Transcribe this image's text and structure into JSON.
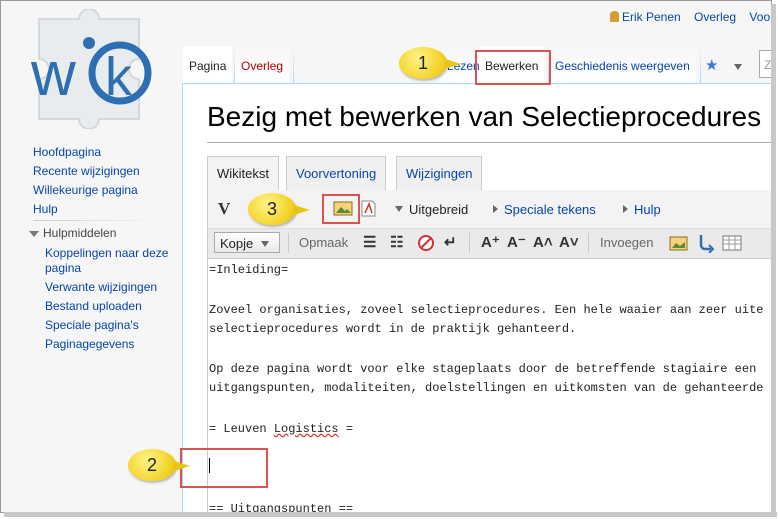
{
  "personal": {
    "user": "Erik Penen",
    "talk": "Overleg",
    "more": "Voor"
  },
  "sidebar": {
    "nav": [
      "Hoofdpagina",
      "Recente wijzigingen",
      "Willekeurige pagina",
      "Hulp"
    ],
    "tools_heading": "Hulpmiddelen",
    "tools": [
      "Koppelingen naar deze pagina",
      "Verwante wijzigingen",
      "Bestand uploaden",
      "Speciale pagina's",
      "Paginagegevens"
    ]
  },
  "tabs": {
    "page": "Pagina",
    "talk": "Overleg",
    "read": "Lezen",
    "edit": "Bewerken",
    "history": "Geschiedenis weergeven",
    "search_placeholder": "Z"
  },
  "page_title": "Bezig met bewerken van Selectieprocedures",
  "editor_tabs": [
    "Wikitekst",
    "Voorvertoning",
    "Wijzigingen"
  ],
  "toolbar1": {
    "advanced": "Uitgebreid",
    "special": "Speciale tekens",
    "help": "Hulp"
  },
  "toolbar2": {
    "heading_select": "Kopje",
    "format": "Opmaak",
    "insert": "Invoegen"
  },
  "editor_lines": [
    "=Inleiding=",
    "",
    "Zoveel organisaties, zoveel selectieprocedures. Een hele waaier aan zeer uite",
    "selectieprocedures wordt in de praktijk gehanteerd.",
    "",
    "Op deze pagina wordt voor elke stageplaats door de betreffende stagiaire een",
    "uitgangspunten, modaliteiten, doelstellingen en uitkomsten van de gehanteerde"
  ],
  "editor_heading": {
    "prefix": "= Leuven ",
    "word": "Logistics",
    "suffix": " ="
  },
  "editor_last_line": "== Uitgangspunten ==",
  "callouts": [
    "1",
    "2",
    "3"
  ],
  "colors": {
    "link": "#0645ad",
    "highlight_box": "#d9534f",
    "callout": "#f2d020"
  },
  "icons": [
    "user-icon",
    "star-icon",
    "bold-icon",
    "image-icon",
    "reference-icon",
    "bullet-list-icon",
    "numbered-list-icon",
    "nowiki-icon",
    "newline-icon",
    "big-text-icon",
    "small-text-icon",
    "superscript-icon",
    "subscript-icon",
    "gallery-icon",
    "redirect-icon",
    "table-icon"
  ]
}
